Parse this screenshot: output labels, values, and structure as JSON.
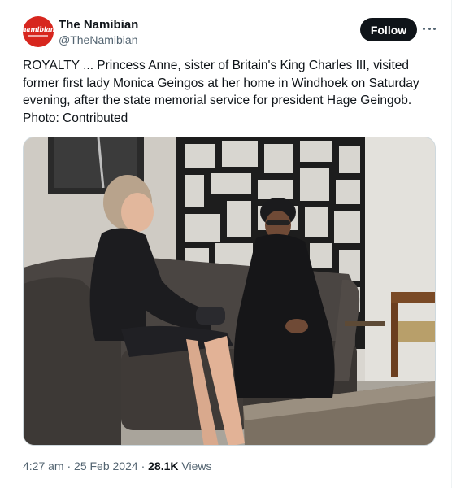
{
  "account": {
    "name": "The Namibian",
    "handle": "@TheNamibian",
    "avatar_text": "namibian"
  },
  "actions": {
    "follow_label": "Follow",
    "more_icon": "more-horizontal-icon"
  },
  "tweet": {
    "text": "ROYALTY ... Princess Anne, sister of Britain's King Charles III, visited former first lady Monica Geingos at her home in Windhoek on Saturday evening, after the state memorial service for president Hage Geingob. Photo: Contributed"
  },
  "meta": {
    "time": "4:27 am",
    "date": "25 Feb 2024",
    "views_count": "28.1K",
    "views_label": "Views"
  }
}
